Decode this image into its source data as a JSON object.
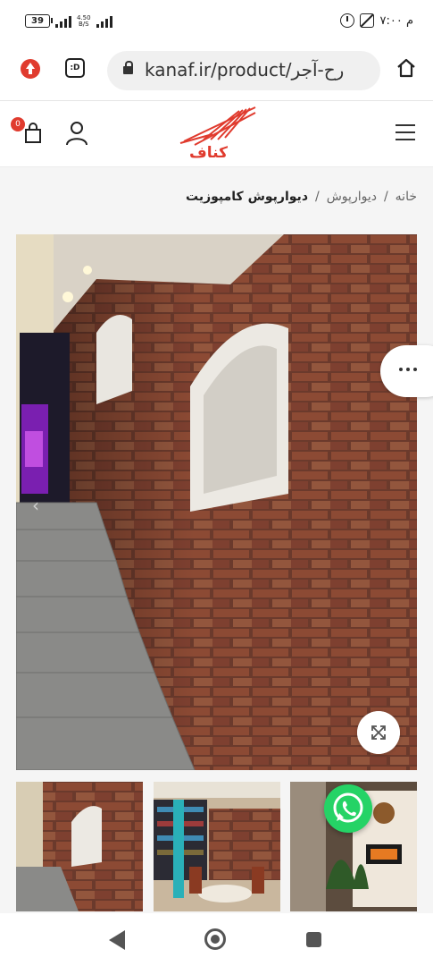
{
  "status": {
    "battery": "39",
    "network_speed": "4.50\nB/S",
    "time": "۷:۰۰ م"
  },
  "browser": {
    "tab_label": ":D",
    "url_domain": "kanaf.ir",
    "url_path": "/product/آجر-طرح",
    "url_display": "kanaf.ir/product/رح-آجر"
  },
  "site": {
    "logo_text": "کناف",
    "cart_count": "0"
  },
  "breadcrumb": {
    "items": [
      "خانه",
      "دیوارپوش",
      "دیوارپوش کامپوزیت"
    ],
    "separator": "/"
  },
  "gallery": {
    "more_label": "⋯"
  },
  "icons": {
    "ext": "upload-icon",
    "home": "home-icon",
    "cart": "cart-icon",
    "user": "user-icon",
    "menu": "hamburger-menu-icon",
    "zoom": "expand-icon",
    "whatsapp": "whatsapp-icon"
  },
  "colors": {
    "brand_red": "#e03b2e",
    "whatsapp_green": "#25d366"
  }
}
